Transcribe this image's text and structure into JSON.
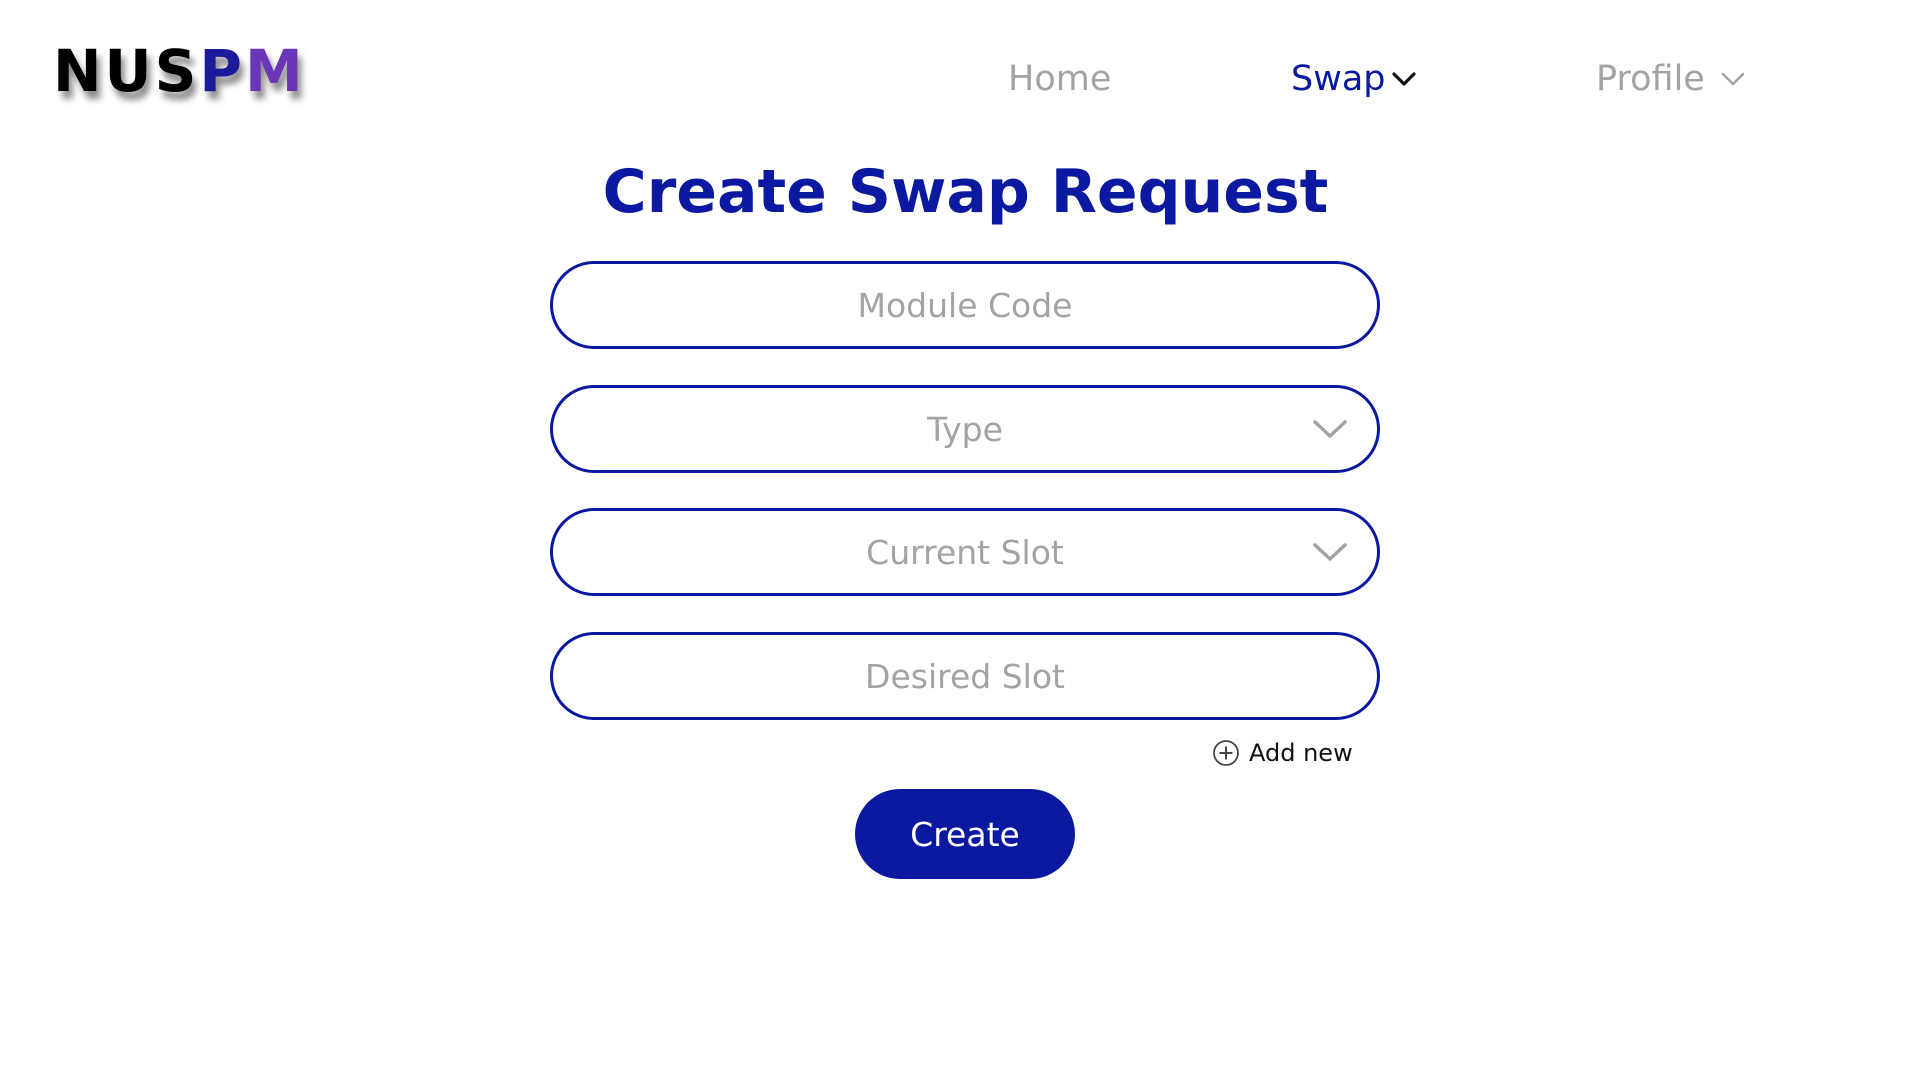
{
  "colors": {
    "brand": "#0b18a0",
    "muted": "#a3a3a3",
    "logo_part1": "#000000",
    "logo_part2": "#1d1a9a",
    "logo_part3": "#6b35b8"
  },
  "header": {
    "logo": {
      "part1": "NUS",
      "part2": "P",
      "part3": "M"
    },
    "nav": [
      {
        "label": "Home",
        "active": false,
        "has_dropdown": false
      },
      {
        "label": "Swap",
        "active": true,
        "has_dropdown": true,
        "icon": "chevron-down-icon"
      },
      {
        "label": "Profile",
        "active": false,
        "has_dropdown": true,
        "icon": "chevron-down-icon"
      }
    ]
  },
  "main": {
    "title": "Create Swap Request",
    "fields": {
      "module_code": {
        "placeholder": "Module Code",
        "value": ""
      },
      "type": {
        "placeholder": "Type",
        "icon": "chevron-down-icon"
      },
      "current_slot": {
        "placeholder": "Current Slot",
        "icon": "chevron-down-icon"
      },
      "desired_slot": {
        "placeholder": "Desired Slot",
        "value": ""
      }
    },
    "add_new": {
      "label": "Add new",
      "icon": "plus-circle-icon"
    },
    "create_button": "Create"
  }
}
